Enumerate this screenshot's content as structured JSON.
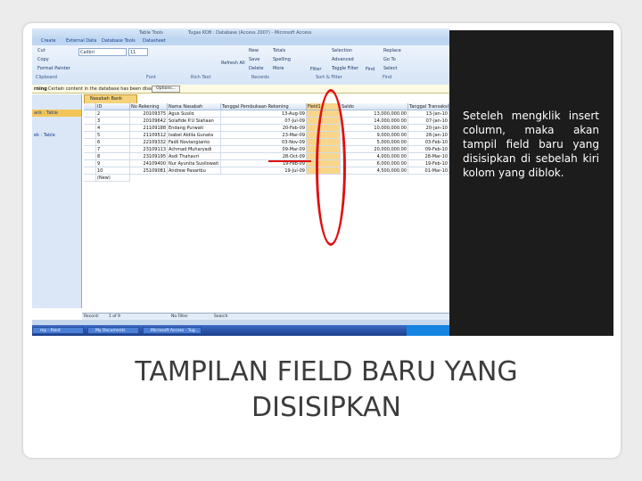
{
  "window": {
    "context_tab": "Table Tools",
    "title": "Tugas KOB : Database (Access 2007) - Microsoft Access"
  },
  "ribbon_tabs": [
    "Create",
    "External Data",
    "Database Tools",
    "Datasheet"
  ],
  "ribbon": {
    "cut": "Cut",
    "copy": "Copy",
    "format_painter": "Format Painter",
    "font_name": "Calibri",
    "font_size": "11",
    "refresh": "Refresh All",
    "new": "New",
    "save": "Save",
    "delete": "Delete",
    "totals": "Totals",
    "spelling": "Spelling",
    "more": "More",
    "filter": "Filter",
    "selection": "Selection",
    "advanced": "Advanced",
    "toggle_filter": "Toggle Filter",
    "find": "Find",
    "replace": "Replace",
    "go_to": "Go To",
    "select": "Select",
    "groups": [
      "Clipboard",
      "Font",
      "Rich Text",
      "Records",
      "Sort & Filter",
      "Find"
    ]
  },
  "message_bar": {
    "label": "rning",
    "text": "Certain content in the database has been disabled",
    "options": "Options..."
  },
  "nav_pane": {
    "item1": "ank : Table",
    "item2": "ek : Table"
  },
  "doc_tab": "Nasabah Bank",
  "table": {
    "headers": [
      "ID",
      "No Rekening",
      "Nama Nasabah",
      "Tanggal Pembukaan Rekening",
      "Field1",
      "Saldo",
      "Tanggal Transaksi Akhir"
    ],
    "rows": [
      [
        "2",
        "20109375",
        "Agus Susilo",
        "13-Aug-09",
        "",
        "13,000,000.00",
        "13-Jan-10"
      ],
      [
        "3",
        "20109642",
        "Solafide P.U Siahaan",
        "07-Jul-09",
        "",
        "14,000,000.00",
        "07-Jan-10"
      ],
      [
        "4",
        "21109188",
        "Endang Purwati",
        "20-Feb-09",
        "",
        "10,000,000.00",
        "20-Jan-10"
      ],
      [
        "5",
        "21109512",
        "Isabel Aldila Gunata",
        "23-Mar-09",
        "",
        "9,000,000.00",
        "28-Jan-10"
      ],
      [
        "6",
        "22109332",
        "Fadli Noviangianto",
        "03-Nov-09",
        "",
        "5,000,000.00",
        "03-Feb-10"
      ],
      [
        "7",
        "23109113",
        "Achmad Muharyadi",
        "09-Mar-09",
        "",
        "20,000,000.00",
        "09-Feb-10"
      ],
      [
        "8",
        "23109195",
        "Asdi Thahavri",
        "28-Oct-09",
        "",
        "4,000,000.00",
        "28-Mar-10"
      ],
      [
        "9",
        "24109400",
        "Nur Ayunita Susilowati",
        "19-Feb-09",
        "",
        "6,000,000.00",
        "19-Feb-10"
      ],
      [
        "10",
        "25109081",
        "Andrew Pasaribu",
        "19-Jul-09",
        "",
        "4,500,000.00",
        "01-Mar-10"
      ]
    ],
    "new_row": "(New)"
  },
  "record_nav": {
    "label": "Record:",
    "position": "1 of 9",
    "filter": "No Filter",
    "search": "Search"
  },
  "taskbar": {
    "item1": "mp - Paint",
    "item2": "My Documents",
    "item3": "Microsoft Access - Tug..."
  },
  "caption": "Seteleh mengklik insert column, maka akan tampil field baru yang disisipkan di sebelah kiri kolom yang diblok.",
  "slide_title": "TAMPILAN FIELD BARU YANG DISISIPKAN",
  "colors": {
    "annotation": "#e01010",
    "dark_panel": "#1c1c1c",
    "ribbon": "#d5e4f6"
  }
}
